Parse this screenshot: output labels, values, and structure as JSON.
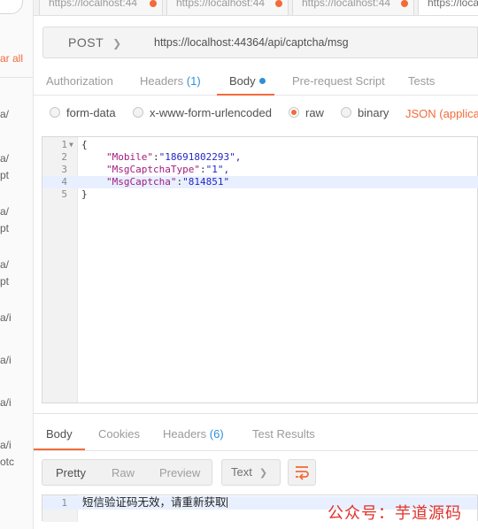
{
  "sidebar": {
    "clear_all": "ar all",
    "fragments": [
      "a/",
      "a/",
      "pt",
      "a/",
      "pt",
      "a/",
      "pt",
      "a/i",
      "a/i",
      "a/i",
      "a/i",
      "otc"
    ]
  },
  "tabs": [
    {
      "label": "https://localhost:44"
    },
    {
      "label": "https://localhost:44"
    },
    {
      "label": "https://localhost:44"
    },
    {
      "label": "https://loca"
    }
  ],
  "request": {
    "method": "POST",
    "url": "https://localhost:44364/api/captcha/msg"
  },
  "request_tabs": {
    "authorization": "Authorization",
    "headers": "Headers",
    "headers_count": "(1)",
    "body": "Body",
    "prerequest": "Pre-request Script",
    "tests": "Tests"
  },
  "body_types": {
    "form_data": "form-data",
    "urlencoded": "x-www-form-urlencoded",
    "raw": "raw",
    "binary": "binary",
    "content_type": "JSON (applicati"
  },
  "editor": {
    "line_numbers": [
      "1",
      "2",
      "3",
      "4",
      "5"
    ],
    "open_brace": "{",
    "close_brace": "}",
    "fields": [
      {
        "key": "\"Mobile\"",
        "value": "\"18691802293\","
      },
      {
        "key": "\"MsgCaptchaType\"",
        "value": "\"1\","
      },
      {
        "key": "\"MsgCaptcha\"",
        "value": "\"814851\""
      }
    ]
  },
  "response_tabs": {
    "body": "Body",
    "cookies": "Cookies",
    "headers": "Headers",
    "headers_count": "(6)",
    "test_results": "Test Results"
  },
  "response_toolbar": {
    "pretty": "Pretty",
    "raw": "Raw",
    "preview": "Preview",
    "format": "Text"
  },
  "response": {
    "line_number": "1",
    "text": "短信验证码无效，请重新获取"
  },
  "watermark": "公众号：芋道源码",
  "colors": {
    "accent": "#f26b3a",
    "link_blue": "#2f8fd8",
    "json_key": "#a21d7d",
    "json_string": "#2626c4"
  }
}
